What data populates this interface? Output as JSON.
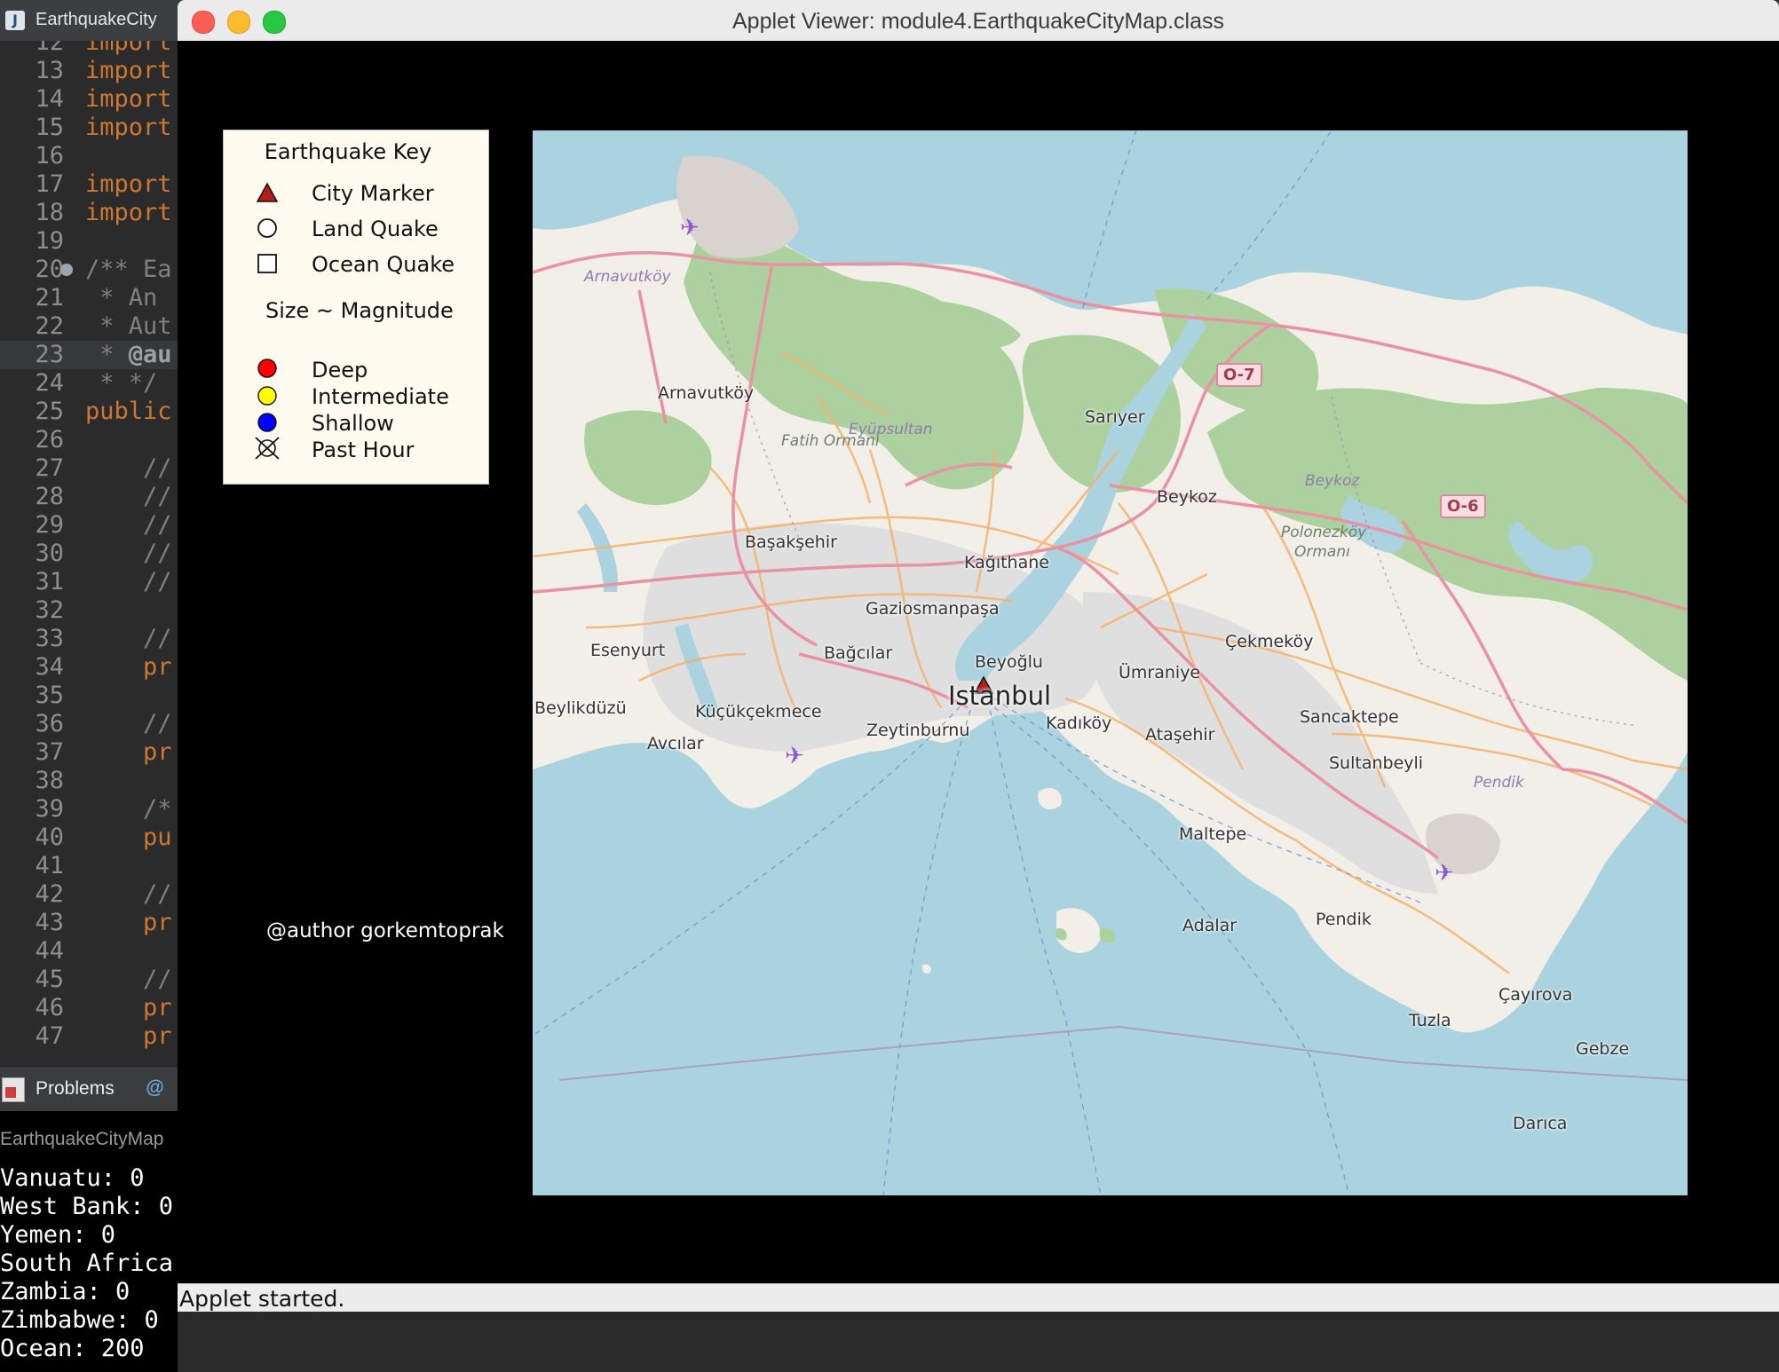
{
  "ide": {
    "tab_title": "EarthquakeCity",
    "code_lines": [
      {
        "num": "12",
        "parts": [
          {
            "t": "import",
            "c": "kw"
          }
        ]
      },
      {
        "num": "13",
        "parts": [
          {
            "t": "import",
            "c": "kw"
          }
        ]
      },
      {
        "num": "14",
        "parts": [
          {
            "t": "import",
            "c": "kw"
          }
        ]
      },
      {
        "num": "15",
        "parts": [
          {
            "t": "import",
            "c": "kw"
          }
        ]
      },
      {
        "num": "16",
        "parts": []
      },
      {
        "num": "17",
        "parts": [
          {
            "t": "import",
            "c": "kw"
          }
        ]
      },
      {
        "num": "18",
        "parts": [
          {
            "t": "import",
            "c": "kw"
          }
        ]
      },
      {
        "num": "19",
        "parts": []
      },
      {
        "num": "20",
        "parts": [
          {
            "t": "/** Ea",
            "c": "cm"
          }
        ],
        "fold": true
      },
      {
        "num": "21",
        "parts": [
          {
            "t": " * An ",
            "c": "cm"
          }
        ]
      },
      {
        "num": "22",
        "parts": [
          {
            "t": " * Aut",
            "c": "cm"
          }
        ]
      },
      {
        "num": "23",
        "parts": [
          {
            "t": " * ",
            "c": "cm"
          },
          {
            "t": "@au",
            "c": "cmb"
          }
        ],
        "highlight": true
      },
      {
        "num": "24",
        "parts": [
          {
            "t": " * */",
            "c": "cm"
          }
        ]
      },
      {
        "num": "25",
        "parts": [
          {
            "t": "public",
            "c": "kw"
          }
        ]
      },
      {
        "num": "26",
        "parts": []
      },
      {
        "num": "27",
        "parts": [
          {
            "t": "    //",
            "c": "cm"
          }
        ]
      },
      {
        "num": "28",
        "parts": [
          {
            "t": "    //",
            "c": "cm"
          }
        ]
      },
      {
        "num": "29",
        "parts": [
          {
            "t": "    //",
            "c": "cm"
          }
        ]
      },
      {
        "num": "30",
        "parts": [
          {
            "t": "    //",
            "c": "cm"
          }
        ]
      },
      {
        "num": "31",
        "parts": [
          {
            "t": "    //",
            "c": "cm"
          }
        ]
      },
      {
        "num": "32",
        "parts": []
      },
      {
        "num": "33",
        "parts": [
          {
            "t": "    //",
            "c": "cm"
          }
        ]
      },
      {
        "num": "34",
        "parts": [
          {
            "t": "    pr",
            "c": "kw"
          }
        ]
      },
      {
        "num": "35",
        "parts": []
      },
      {
        "num": "36",
        "parts": [
          {
            "t": "    //",
            "c": "cm"
          }
        ]
      },
      {
        "num": "37",
        "parts": [
          {
            "t": "    pr",
            "c": "kw"
          }
        ]
      },
      {
        "num": "38",
        "parts": []
      },
      {
        "num": "39",
        "parts": [
          {
            "t": "    /*",
            "c": "cm"
          }
        ]
      },
      {
        "num": "40",
        "parts": [
          {
            "t": "    pu",
            "c": "kw"
          }
        ]
      },
      {
        "num": "41",
        "parts": []
      },
      {
        "num": "42",
        "parts": [
          {
            "t": "    //",
            "c": "cm"
          }
        ]
      },
      {
        "num": "43",
        "parts": [
          {
            "t": "    pr",
            "c": "kw"
          }
        ]
      },
      {
        "num": "44",
        "parts": []
      },
      {
        "num": "45",
        "parts": [
          {
            "t": "    //",
            "c": "cm"
          }
        ]
      },
      {
        "num": "46",
        "parts": [
          {
            "t": "    pr",
            "c": "kw"
          }
        ]
      },
      {
        "num": "47",
        "parts": [
          {
            "t": "    pr",
            "c": "kw"
          }
        ]
      }
    ],
    "problems_tab": "Problems",
    "javadoc_tab_icon": "@",
    "console_header": "EarthquakeCityMap",
    "console_lines": [
      "Vanuatu: 0",
      "West Bank: 0",
      "Yemen: 0",
      "South Africa",
      "Zambia: 0",
      "Zimbabwe: 0",
      "Ocean: 200"
    ]
  },
  "applet": {
    "title": "Applet Viewer: module4.EarthquakeCityMap.class",
    "status": "Applet started.",
    "author": "@author gorkemtoprak"
  },
  "legend": {
    "title": "Earthquake Key",
    "city_marker": "City Marker",
    "land_quake": "Land Quake",
    "ocean_quake": "Ocean Quake",
    "size_label": "Size ~ Magnitude",
    "deep": "Deep",
    "intermediate": "Intermediate",
    "shallow": "Shallow",
    "past_hour": "Past Hour",
    "colors": {
      "city": "#b21e1e",
      "deep": "#ff0000",
      "intermediate": "#ffff00",
      "shallow": "#0000ff"
    }
  },
  "map": {
    "city_label": "Istanbul",
    "labels": {
      "arnavutkoy": "Arnavutköy",
      "sariyer": "Sarıyer",
      "beykoz": "Beykoz",
      "basaksehir": "Başakşehir",
      "kagithane": "Kağıthane",
      "gaziosmanpasa": "Gaziosmanpaşa",
      "esenyurt": "Esenyurt",
      "bagcilar": "Bağcılar",
      "beyoglu": "Beyoğlu",
      "umraniye": "Ümraniye",
      "cekmekoy": "Çekmeköy",
      "beylikduzu": "Beylikdüzü",
      "kucukcekmece": "Küçükçekmece",
      "zeytinburnu": "Zeytinburnu",
      "kadikoy": "Kadıköy",
      "atasehir": "Ataşehir",
      "sancaktepe": "Sancaktepe",
      "sultanbeyli": "Sultanbeyli",
      "avcilar": "Avcılar",
      "maltepe": "Maltepe",
      "adalar": "Adalar",
      "pendik": "Pendik",
      "cayirova": "Çayırova",
      "tuzla": "Tuzla",
      "gebze": "Gebze",
      "darica": "Darıca"
    },
    "italic_labels": {
      "arnavutkoy_purple": "Arnavutköy",
      "eyupsultan": "Eyüpsultan",
      "beykoz_purple": "Beykoz",
      "pendik_purple": "Pendik"
    },
    "forest_labels": {
      "fatih_ormani": "Fatih Ormanı",
      "polonezkoy": "Polonezköy",
      "ormani": "Ormanı"
    },
    "road_shields": {
      "o7": "O-7",
      "o6": "O-6"
    },
    "colors": {
      "sea": "#aad3df",
      "land": "#f2efe9",
      "forest": "#add19e",
      "urban": "#e0dfdf",
      "motorway": "#e892a2",
      "primary": "#fcd6a4"
    }
  }
}
